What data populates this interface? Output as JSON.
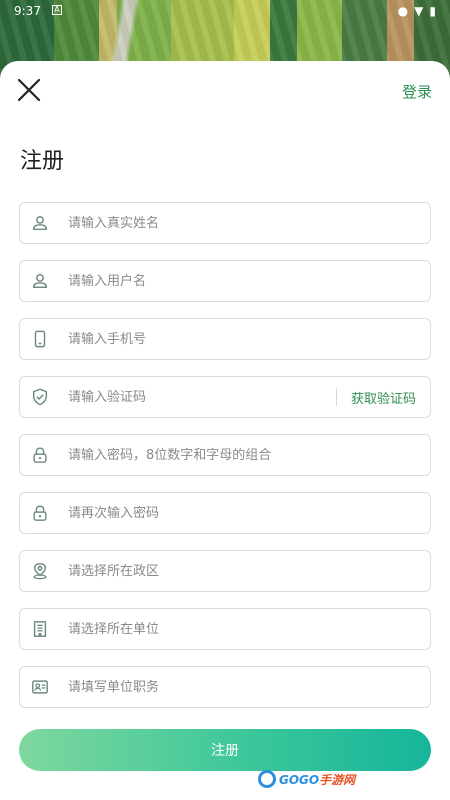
{
  "status_bar": {
    "time": "9:37",
    "notification_letter": "A"
  },
  "header": {
    "login_label": "登录",
    "title": "注册"
  },
  "fields": {
    "real_name": {
      "placeholder": "请输入真实姓名",
      "icon": "user-icon"
    },
    "username": {
      "placeholder": "请输入用户名",
      "icon": "user-icon"
    },
    "phone": {
      "placeholder": "请输入手机号",
      "icon": "phone-icon"
    },
    "verify_code": {
      "placeholder": "请输入验证码",
      "icon": "shield-check-icon",
      "action_label": "获取验证码"
    },
    "password": {
      "placeholder": "请输入密码，8位数字和字母的组合",
      "icon": "lock-icon"
    },
    "password_confirm": {
      "placeholder": "请再次输入密码",
      "icon": "lock-icon"
    },
    "region": {
      "placeholder": "请选择所在政区",
      "icon": "location-pin-icon"
    },
    "organization": {
      "placeholder": "请选择所在单位",
      "icon": "building-icon"
    },
    "position": {
      "placeholder": "请填写单位职务",
      "icon": "id-card-icon"
    }
  },
  "submit": {
    "label": "注册"
  },
  "watermark": {
    "prefix": "GOGO",
    "suffix": "手游网"
  },
  "colors": {
    "accent": "#2f8f55",
    "icon": "#6f8a7d",
    "button_start": "#7fd79e",
    "button_end": "#16b59a"
  }
}
